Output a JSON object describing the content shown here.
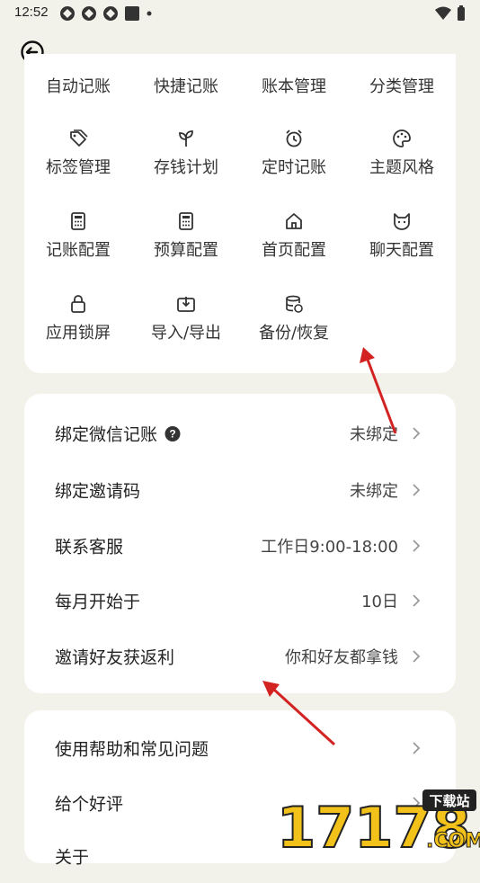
{
  "status_bar": {
    "time": "12:52",
    "icons": [
      "app-icon",
      "app-icon",
      "app-icon",
      "square-icon",
      "dot-icon",
      "wifi-icon",
      "battery-icon"
    ]
  },
  "header": {
    "back_icon": "back-arrow-circle-icon"
  },
  "grid": {
    "rows": [
      [
        {
          "label": "自动记账",
          "icon": "auto-icon"
        },
        {
          "label": "快捷记账",
          "icon": "quick-icon"
        },
        {
          "label": "账本管理",
          "icon": "book-icon"
        },
        {
          "label": "分类管理",
          "icon": "category-icon"
        }
      ],
      [
        {
          "label": "标签管理",
          "icon": "tag-icon"
        },
        {
          "label": "存钱计划",
          "icon": "sprout-icon"
        },
        {
          "label": "定时记账",
          "icon": "alarm-icon"
        },
        {
          "label": "主题风格",
          "icon": "palette-icon"
        }
      ],
      [
        {
          "label": "记账配置",
          "icon": "calculator-icon"
        },
        {
          "label": "预算配置",
          "icon": "calculator-icon"
        },
        {
          "label": "首页配置",
          "icon": "home-icon"
        },
        {
          "label": "聊天配置",
          "icon": "cat-icon"
        }
      ],
      [
        {
          "label": "应用锁屏",
          "icon": "lock-icon"
        },
        {
          "label": "导入/导出",
          "icon": "import-export-icon"
        },
        {
          "label": "备份/恢复",
          "icon": "database-restore-icon"
        }
      ]
    ]
  },
  "settings": [
    {
      "title": "绑定微信记账",
      "value": "未绑定",
      "help": true
    },
    {
      "title": "绑定邀请码",
      "value": "未绑定"
    },
    {
      "title": "联系客服",
      "value": "工作日9:00-18:00"
    },
    {
      "title": "每月开始于",
      "value": "10日"
    },
    {
      "title": "邀请好友获返利",
      "value": "你和好友都拿钱"
    }
  ],
  "help_section": [
    {
      "title": "使用帮助和常见问题"
    },
    {
      "title": "给个好评"
    },
    {
      "title": "关于"
    }
  ],
  "watermark": {
    "text": "17178",
    "badge": "下载站",
    "domain": ".COM"
  },
  "colors": {
    "background": "#f3f2ea",
    "card": "#ffffff",
    "arrow": "#d32222",
    "chevron": "#9a9a9a"
  }
}
